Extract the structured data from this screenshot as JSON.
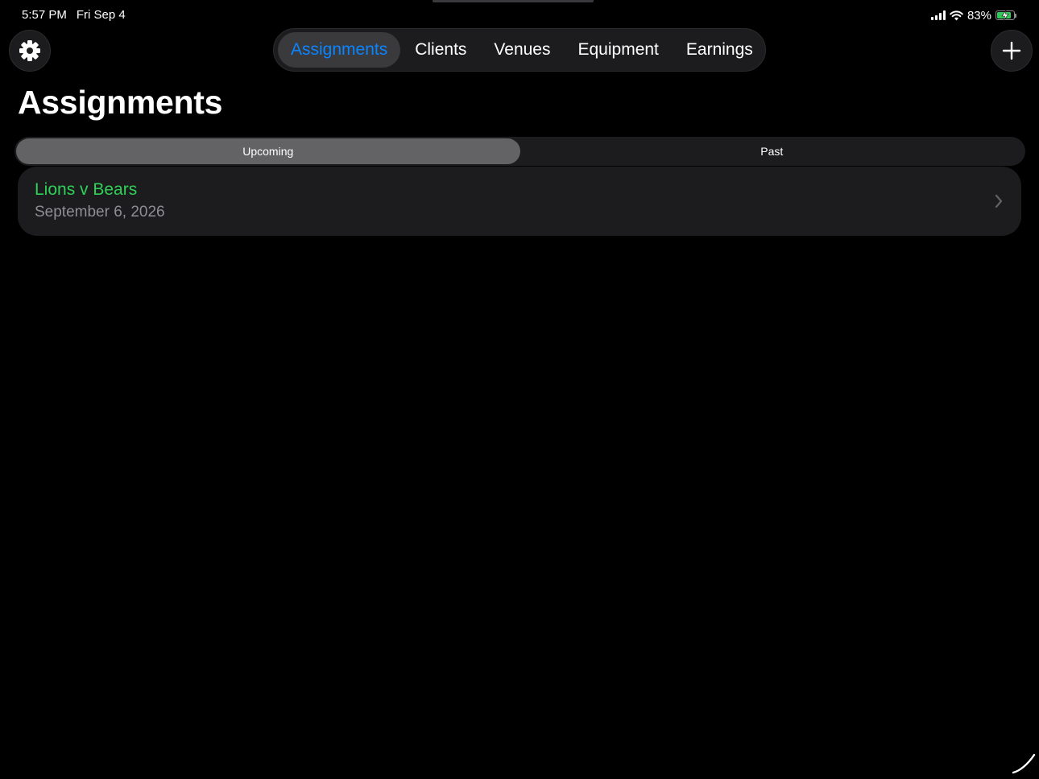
{
  "status_bar": {
    "time": "5:57 PM",
    "date": "Fri Sep 4",
    "battery_percent": "83%",
    "battery_level": 0.83,
    "signal_icon": "cellular-signal-icon",
    "wifi_icon": "wifi-icon",
    "battery_icon": "battery-charging-icon"
  },
  "toolbar": {
    "settings_icon": "gear-icon",
    "add_icon": "plus-icon"
  },
  "nav": {
    "tabs": [
      {
        "label": "Assignments",
        "active": true
      },
      {
        "label": "Clients",
        "active": false
      },
      {
        "label": "Venues",
        "active": false
      },
      {
        "label": "Equipment",
        "active": false
      },
      {
        "label": "Earnings",
        "active": false
      }
    ]
  },
  "page": {
    "title": "Assignments"
  },
  "segmented": {
    "options": [
      {
        "label": "Upcoming",
        "selected": true
      },
      {
        "label": "Past",
        "selected": false
      }
    ]
  },
  "assignments": [
    {
      "title": "Lions v Bears",
      "date": "September 6, 2026",
      "icon": "chevron-right-icon"
    }
  ],
  "colors": {
    "accent": "#0a84ff",
    "title_green": "#30d158",
    "background": "#000000",
    "surface": "#1c1c1e"
  }
}
